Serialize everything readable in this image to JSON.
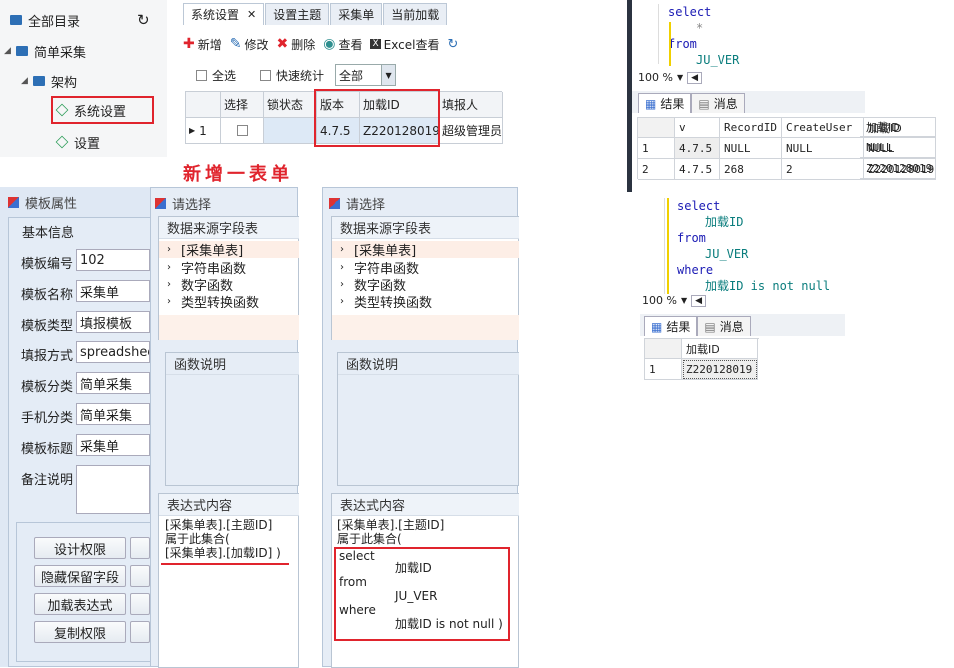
{
  "tree": {
    "root": "全部目录",
    "folder1": "简单采集",
    "folder2": "架构",
    "item1": "系统设置",
    "item2": "设置"
  },
  "tabs": [
    "系统设置",
    "设置主题",
    "采集单",
    "当前加载"
  ],
  "toolbar": {
    "add": "新增",
    "edit": "修改",
    "delete": "删除",
    "view": "查看",
    "excel": "Excel查看"
  },
  "filter": {
    "select_all": "全选",
    "quick_stats": "快速统计",
    "combo_value": "全部"
  },
  "grid": {
    "headers": [
      "选择",
      "锁状态",
      "版本",
      "加载ID",
      "填报人"
    ],
    "row": {
      "num": "1",
      "version": "4.7.5",
      "load_id": "Z220128019",
      "reporter": "超级管理员"
    }
  },
  "annotation": "新增一表单",
  "props": {
    "title": "模板属性",
    "group": "基本信息",
    "fields": [
      {
        "label": "模板编号",
        "value": "102"
      },
      {
        "label": "模板名称",
        "value": "采集单"
      },
      {
        "label": "模板类型",
        "value": "填报模板"
      },
      {
        "label": "填报方式",
        "value": "spreadsheet"
      },
      {
        "label": "模板分类",
        "value": "简单采集"
      },
      {
        "label": "手机分类",
        "value": "简单采集"
      },
      {
        "label": "模板标题",
        "value": "采集单"
      },
      {
        "label": "备注说明",
        "value": ""
      }
    ],
    "buttons": [
      "设计权限",
      "隐藏保留字段",
      "加载表达式",
      "复制权限"
    ]
  },
  "dialog": {
    "title": "请选择",
    "source_head": "数据来源字段表",
    "items": [
      "[采集单表]",
      "字符串函数",
      "数字函数",
      "类型转换函数"
    ],
    "func_head": "函数说明",
    "expr_head": "表达式内容",
    "expr1": [
      "[采集单表].[主题ID]",
      "属于此集合(",
      "[采集单表].[加载ID] )"
    ],
    "expr2_head": [
      "[采集单表].[主题ID]",
      "属于此集合("
    ],
    "expr2_sql": {
      "select": "select",
      "col": "加载ID",
      "from": "from",
      "table": "JU_VER",
      "where": "where",
      "cond": "加载ID is not null )"
    }
  },
  "ssms1": {
    "sql": [
      "select",
      "*",
      "from",
      "JU_VER"
    ],
    "zoom": "100 %",
    "tab_result": "结果",
    "tab_msg": "消息",
    "headers": [
      "v",
      "RecordID",
      "CreateUser",
      "加载ID"
    ],
    "rows": [
      [
        "1",
        "4.7.5",
        "NULL",
        "NULL",
        "NULL"
      ],
      [
        "2",
        "4.7.5",
        "268",
        "2",
        "Z220128019"
      ]
    ]
  },
  "ssms2": {
    "sql": [
      "select",
      "加载ID",
      "from",
      "JU_VER",
      "where",
      "加载ID is not null"
    ],
    "zoom": "100 %",
    "tab_result": "结果",
    "tab_msg": "消息",
    "header": "加载ID",
    "rows": [
      [
        "1",
        "Z220128019"
      ]
    ]
  }
}
